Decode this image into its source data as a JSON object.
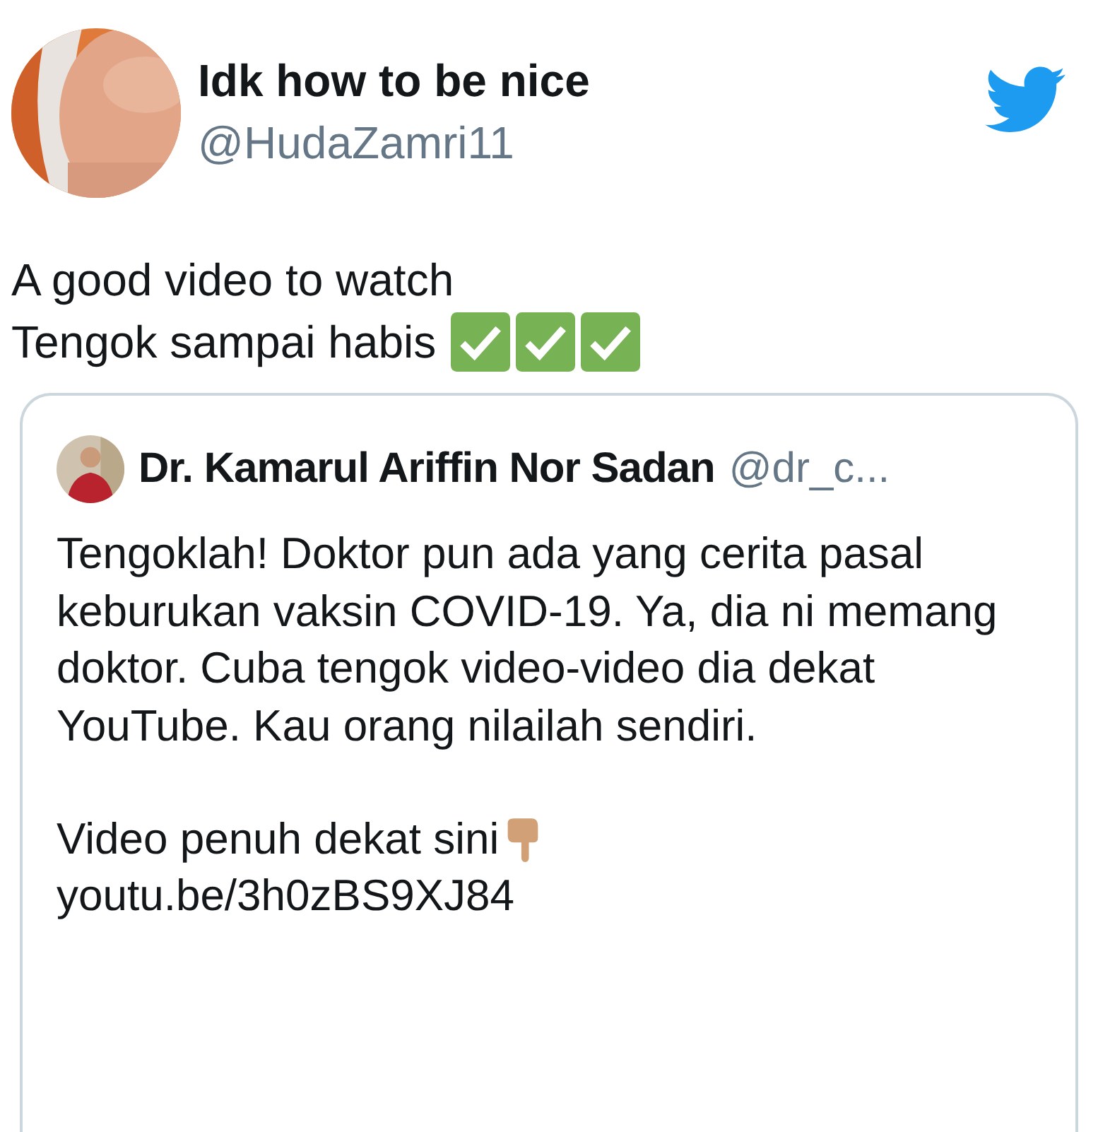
{
  "tweet": {
    "display_name": "Idk how to be nice",
    "handle": "@HudaZamri11",
    "text_lines": [
      "A good video to watch",
      "Tengok sampai habis"
    ],
    "quoted": {
      "display_name": "Dr. Kamarul Ariffin Nor Sadan",
      "handle": "@dr_c...",
      "paragraphs": [
        "Tengoklah! Doktor pun ada yang cerita pasal keburukan vaksin COVID-19. Ya, dia ni memang doktor. Cuba tengok video-video dia dekat YouTube. Kau orang nilailah sendiri.",
        "Video penuh dekat sini"
      ],
      "link": "youtu.be/3h0zBS9XJ84"
    }
  }
}
